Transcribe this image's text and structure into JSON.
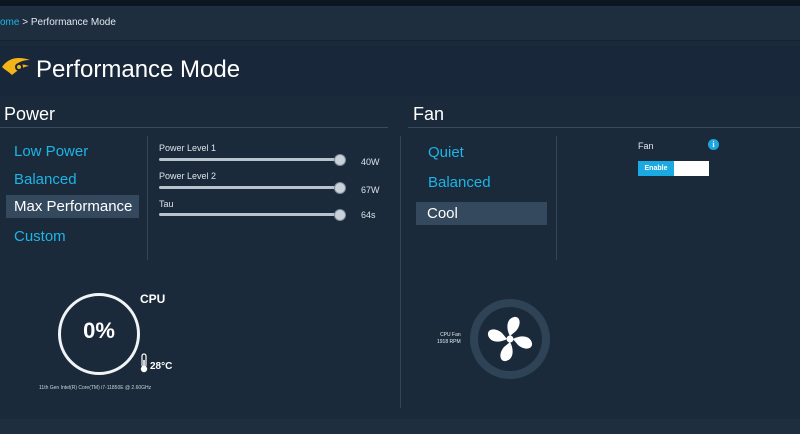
{
  "breadcrumb": {
    "home": "ome",
    "separator": " > ",
    "current": "Performance Mode"
  },
  "page": {
    "title": "Performance Mode",
    "logo_icon": "performance-flame-logo"
  },
  "power": {
    "title": "Power",
    "modes": [
      {
        "label": "Low Power",
        "selected": false
      },
      {
        "label": "Balanced",
        "selected": false
      },
      {
        "label": "Max Performance",
        "selected": true
      },
      {
        "label": "Custom",
        "selected": false
      }
    ],
    "sliders": [
      {
        "label": "Power Level 1",
        "value": "40W",
        "level": 1.0
      },
      {
        "label": "Power Level 2",
        "value": "67W",
        "level": 1.0
      },
      {
        "label": "Tau",
        "value": "64s",
        "level": 1.0
      }
    ]
  },
  "cpu": {
    "title": "CPU",
    "usage": "0%",
    "temperature": "28°C",
    "name": "11th Gen Intel(R) Core(TM) i7-11850Ε @ 2.60GHz"
  },
  "fan": {
    "title": "Fan",
    "modes": [
      {
        "label": "Quiet",
        "selected": false
      },
      {
        "label": "Balanced",
        "selected": false
      },
      {
        "label": "Cool",
        "selected": true
      }
    ],
    "gauge_label_line1": "CPU Fan",
    "gauge_label_line2": "1918 RPM",
    "option_label": "Fan",
    "toggle_label": "Enable",
    "toggle_on": true
  },
  "colors": {
    "accent": "#1db4e6",
    "background": "#1b2a3a",
    "selected": "#34495e"
  }
}
